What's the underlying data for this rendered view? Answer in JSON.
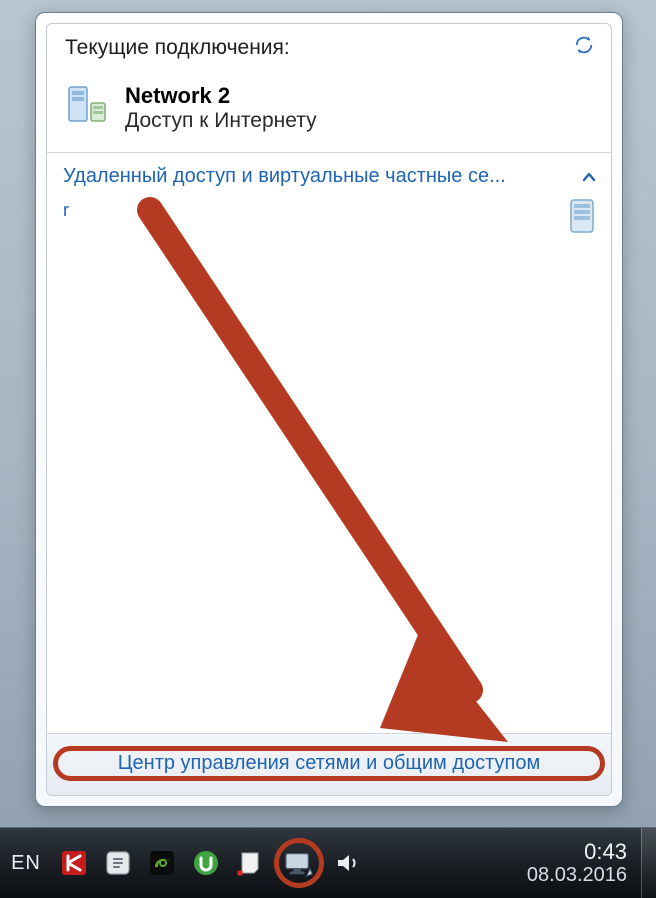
{
  "popup": {
    "title": "Текущие подключения:",
    "refresh_label": "Обновить",
    "network": {
      "name": "Network  2",
      "status": "Доступ к Интернету"
    },
    "vpn": {
      "header": "Удаленный доступ и виртуальные частные се...",
      "item": "r"
    },
    "footer_link": "Центр управления сетями и общим доступом"
  },
  "taskbar": {
    "lang": "EN",
    "tray_icons": [
      "kaspersky-icon",
      "skype-icon",
      "nvidia-icon",
      "utorrent-icon",
      "action-center-icon",
      "network-icon",
      "volume-icon"
    ],
    "clock": {
      "time": "0:43",
      "date": "08.03.2016"
    }
  }
}
